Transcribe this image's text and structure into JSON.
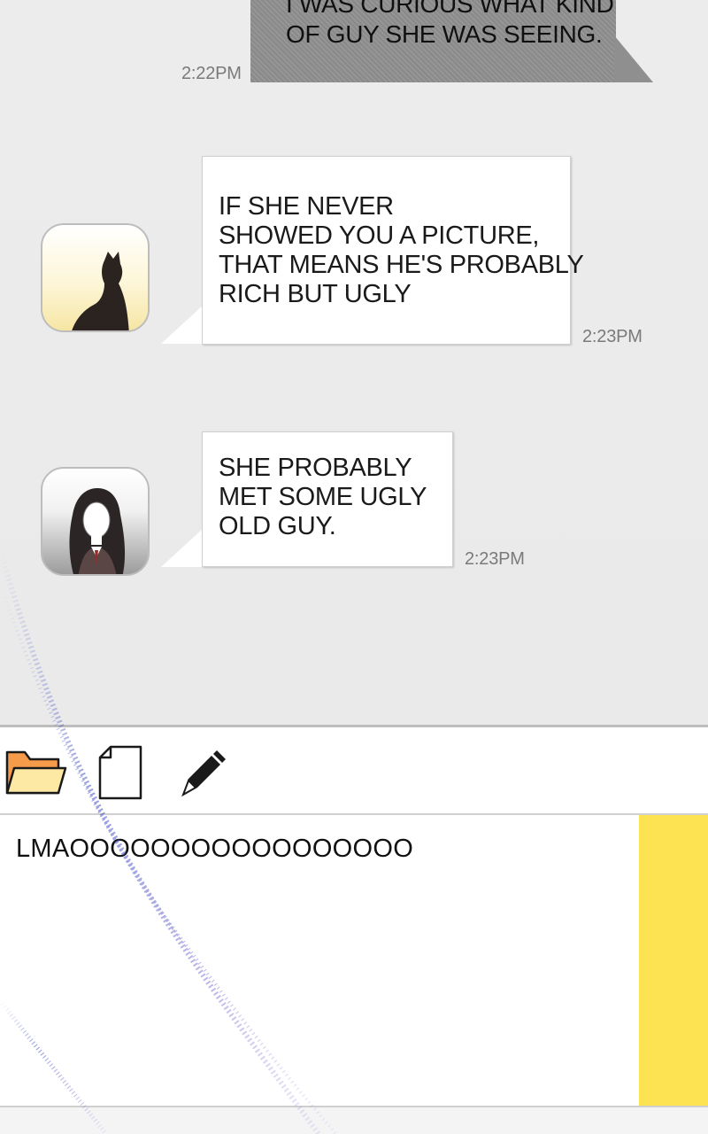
{
  "messages": [
    {
      "direction": "outgoing",
      "lines": [
        "I WAS CURIOUS WHAT KIND",
        "OF GUY SHE WAS SEEING."
      ],
      "time": "2:22PM"
    },
    {
      "direction": "incoming",
      "avatar": "cat-avatar",
      "lines": [
        "IF SHE NEVER",
        "SHOWED YOU A PICTURE,",
        "THAT MEANS HE'S PROBABLY",
        "RICH BUT UGLY"
      ],
      "time": "2:23PM"
    },
    {
      "direction": "incoming",
      "avatar": "girl-avatar",
      "lines": [
        "SHE PROBABLY",
        "MET SOME UGLY",
        "OLD GUY."
      ],
      "time": "2:23PM"
    }
  ],
  "toolbar": {
    "icons": [
      "folder-icon",
      "file-icon",
      "pencil-icon"
    ]
  },
  "composer": {
    "value": "LMAOOOOOOOOOOOOOOOOO"
  },
  "colors": {
    "outgoing_bubble": "#8f8f8f",
    "incoming_bubble": "#ffffff",
    "send_panel": "#fde352",
    "folder": "#f8a64d"
  }
}
